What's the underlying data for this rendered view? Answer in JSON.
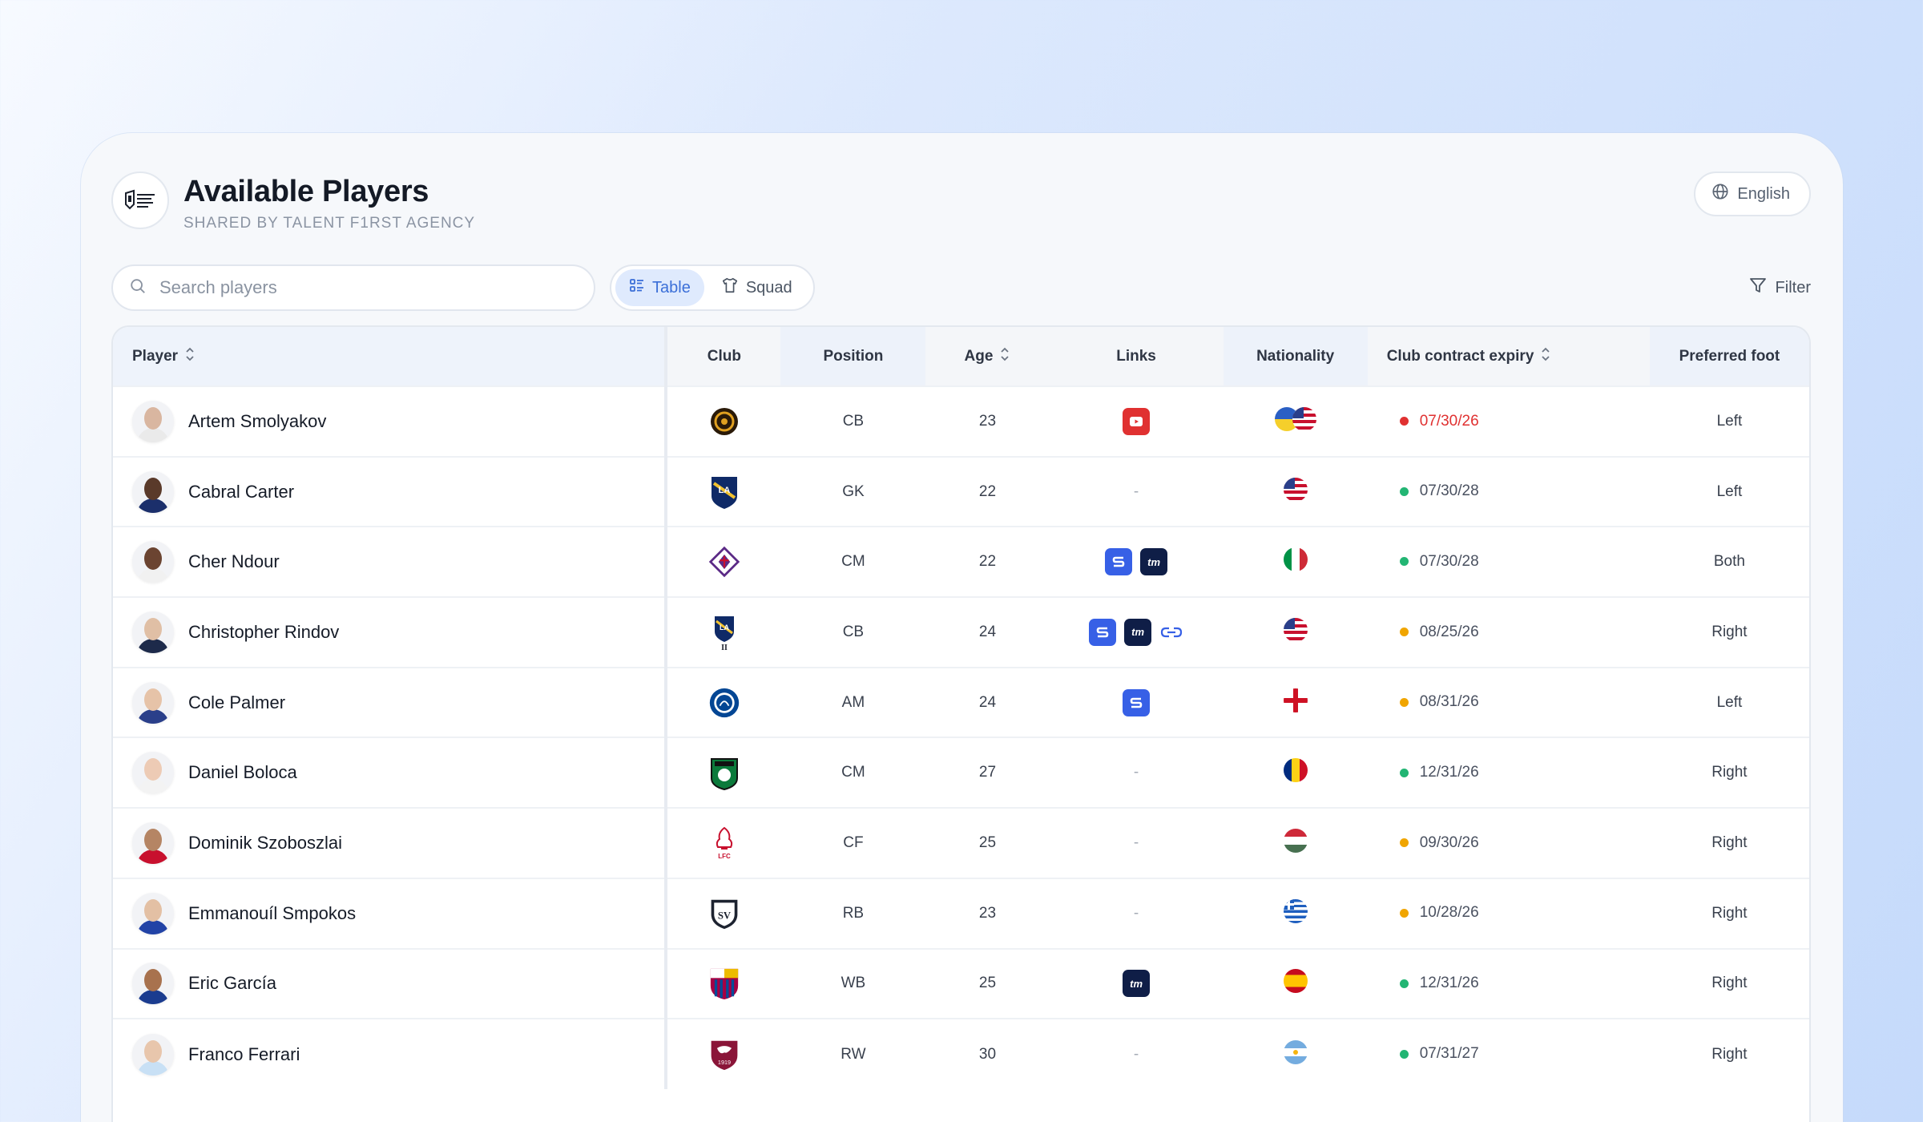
{
  "header": {
    "title": "Available Players",
    "subtitle": "SHARED BY TALENT F1RST AGENCY",
    "language": "English"
  },
  "toolbar": {
    "search_placeholder": "Search players",
    "view_table": "Table",
    "view_squad": "Squad",
    "filter": "Filter"
  },
  "columns": {
    "player": "Player",
    "club": "Club",
    "position": "Position",
    "age": "Age",
    "links": "Links",
    "nationality": "Nationality",
    "contract": "Club contract expiry",
    "foot": "Preferred foot"
  },
  "colors": {
    "accent": "#3b6fd8",
    "red": "#e03131",
    "green": "#22b573",
    "amber": "#f0a500"
  },
  "players": [
    {
      "name": "Artem Smolyakov",
      "club_icon": "club-crest-dark-icon",
      "position": "CB",
      "age": "23",
      "links": [
        "youtube"
      ],
      "nationality": [
        "ua",
        "us"
      ],
      "expiry": "07/30/26",
      "status": "red",
      "foot": "Left"
    },
    {
      "name": "Cabral Carter",
      "club_icon": "la-galaxy-crest-icon",
      "position": "GK",
      "age": "22",
      "links": [],
      "nationality": [
        "us"
      ],
      "expiry": "07/30/28",
      "status": "green",
      "foot": "Left"
    },
    {
      "name": "Cher Ndour",
      "club_icon": "fiorentina-crest-icon",
      "position": "CM",
      "age": "22",
      "links": [
        "scout",
        "transfermarkt"
      ],
      "nationality": [
        "it"
      ],
      "expiry": "07/30/28",
      "status": "green",
      "foot": "Both"
    },
    {
      "name": "Christopher Rindov",
      "club_icon": "la-galaxy-ii-crest-icon",
      "position": "CB",
      "age": "24",
      "links": [
        "scout",
        "transfermarkt",
        "link"
      ],
      "nationality": [
        "us"
      ],
      "expiry": "08/25/26",
      "status": "amber",
      "foot": "Right"
    },
    {
      "name": "Cole Palmer",
      "club_icon": "chelsea-crest-icon",
      "position": "AM",
      "age": "24",
      "links": [
        "scout"
      ],
      "nationality": [
        "en"
      ],
      "expiry": "08/31/26",
      "status": "amber",
      "foot": "Left"
    },
    {
      "name": "Daniel Boloca",
      "club_icon": "sassuolo-crest-icon",
      "position": "CM",
      "age": "27",
      "links": [],
      "nationality": [
        "ro"
      ],
      "expiry": "12/31/26",
      "status": "green",
      "foot": "Right"
    },
    {
      "name": "Dominik Szoboszlai",
      "club_icon": "liverpool-crest-icon",
      "position": "CF",
      "age": "25",
      "links": [],
      "nationality": [
        "hu"
      ],
      "expiry": "09/30/26",
      "status": "amber",
      "foot": "Right"
    },
    {
      "name": "Emmanouíl Smpokos",
      "club_icon": "svr-crest-icon",
      "position": "RB",
      "age": "23",
      "links": [],
      "nationality": [
        "gr"
      ],
      "expiry": "10/28/26",
      "status": "amber",
      "foot": "Right"
    },
    {
      "name": "Eric García",
      "club_icon": "barcelona-crest-icon",
      "position": "WB",
      "age": "25",
      "links": [
        "transfermarkt"
      ],
      "nationality": [
        "es"
      ],
      "expiry": "12/31/26",
      "status": "green",
      "foot": "Right"
    },
    {
      "name": "Franco Ferrari",
      "club_icon": "salernitana-crest-icon",
      "position": "RW",
      "age": "30",
      "links": [],
      "nationality": [
        "ar"
      ],
      "expiry": "07/31/27",
      "status": "green",
      "foot": "Right"
    }
  ]
}
